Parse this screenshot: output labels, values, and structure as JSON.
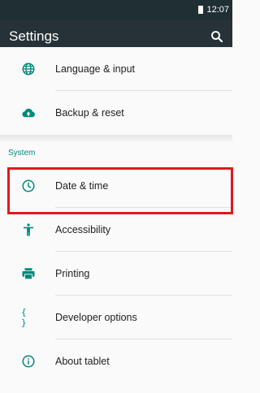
{
  "status_bar": {
    "time": "12:07"
  },
  "toolbar": {
    "title": "Settings"
  },
  "settings": {
    "language": "Language & input",
    "backup": "Backup & reset",
    "system_header": "System",
    "date_time": "Date & time",
    "accessibility": "Accessibility",
    "printing": "Printing",
    "developer": "Developer options",
    "developer_icon": "{ }",
    "about": "About tablet"
  },
  "colors": {
    "accent": "#00897b",
    "toolbar": "#263238",
    "highlight": "#e0191f"
  }
}
